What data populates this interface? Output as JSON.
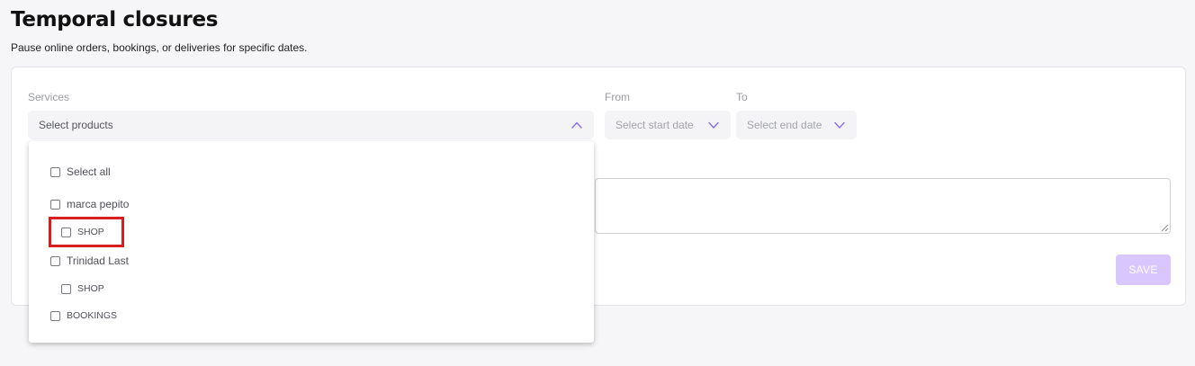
{
  "header": {
    "title": "Temporal closures",
    "subtitle": "Pause online orders, bookings, or deliveries for specific dates."
  },
  "form": {
    "services_label": "Services",
    "services_placeholder": "Select products",
    "from_label": "From",
    "from_placeholder": "Select start date",
    "to_label": "To",
    "to_placeholder": "Select end date",
    "save_label": "SAVE"
  },
  "dropdown": {
    "options": [
      {
        "label": "Select all",
        "level": 0,
        "checked": false
      },
      {
        "label": "marca pepito",
        "level": 0,
        "checked": false
      },
      {
        "label": "SHOP",
        "level": 1,
        "checked": false,
        "highlighted": true
      },
      {
        "label": "Trinidad Last",
        "level": 0,
        "checked": false
      },
      {
        "label": "SHOP",
        "level": 1,
        "checked": false
      },
      {
        "label": "BOOKINGS",
        "level": 0,
        "checked": false
      }
    ]
  },
  "icons": {
    "services_toggle": "chevron-up-icon",
    "date_toggle": "chevron-down-icon"
  },
  "colors": {
    "accent": "#8b6cf0",
    "save_disabled": "#d8c7ff",
    "highlight": "#d71f1f"
  }
}
